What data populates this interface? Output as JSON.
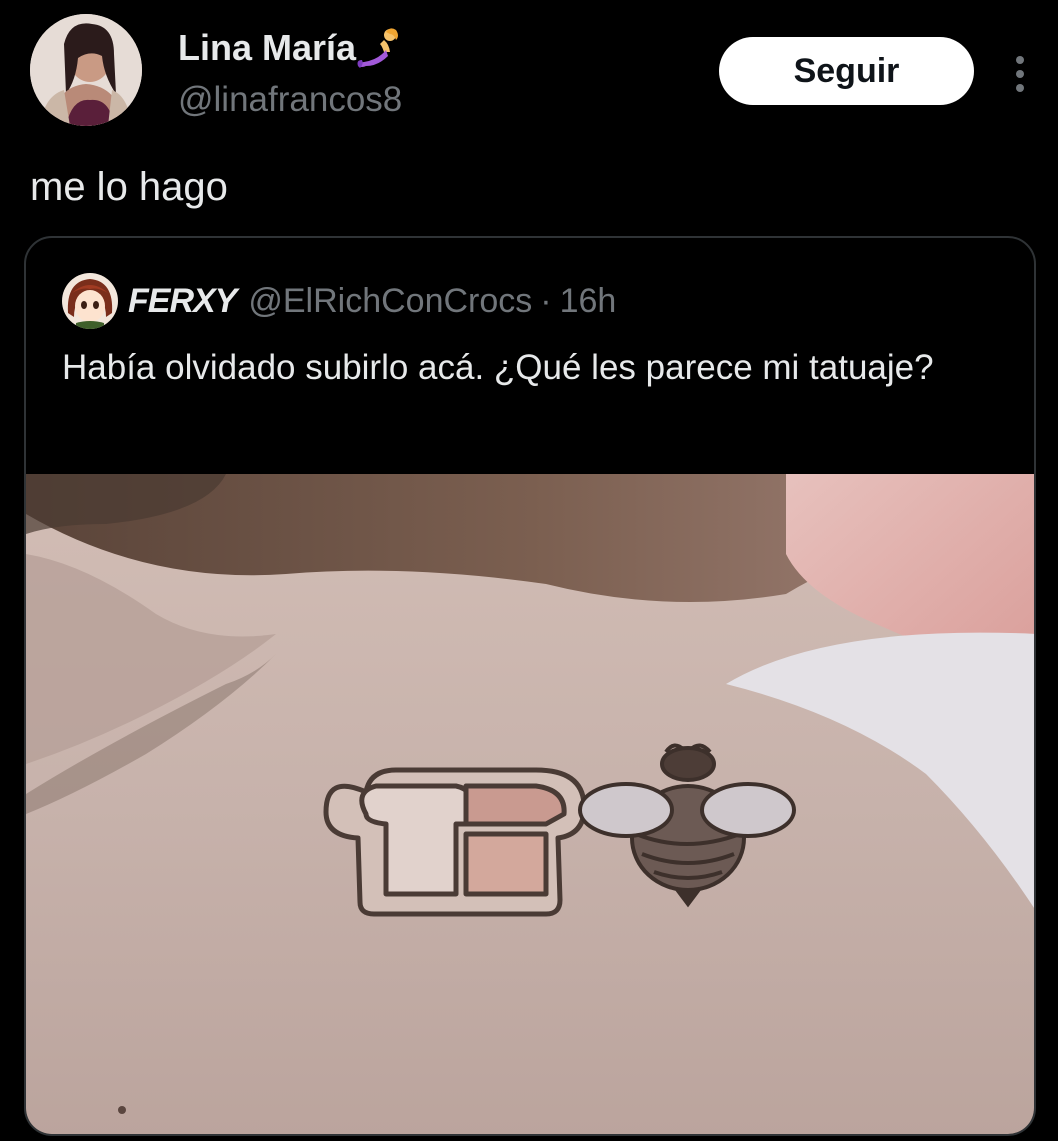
{
  "tweet": {
    "author": {
      "name": "Lina María",
      "handle": "@linafrancos8",
      "name_emoji": "mermaid-emoji"
    },
    "follow_label": "Seguir",
    "more_icon": "more-vertical-icon",
    "text": "me lo hago"
  },
  "quoted": {
    "author_name": "FERXY",
    "author_handle": "@ElRichConCrocs",
    "separator": "·",
    "time": "16h",
    "text": "Había olvidado subirlo acá. ¿Qué les parece mi tatuaje?",
    "media": "photo-shoulder-tattoo-bread-and-bee"
  },
  "colors": {
    "background": "#000000",
    "primary_text": "#e7e9ea",
    "secondary_text": "#71767b",
    "border": "#2f3336",
    "follow_bg": "#ffffff",
    "follow_text": "#0f1419"
  }
}
